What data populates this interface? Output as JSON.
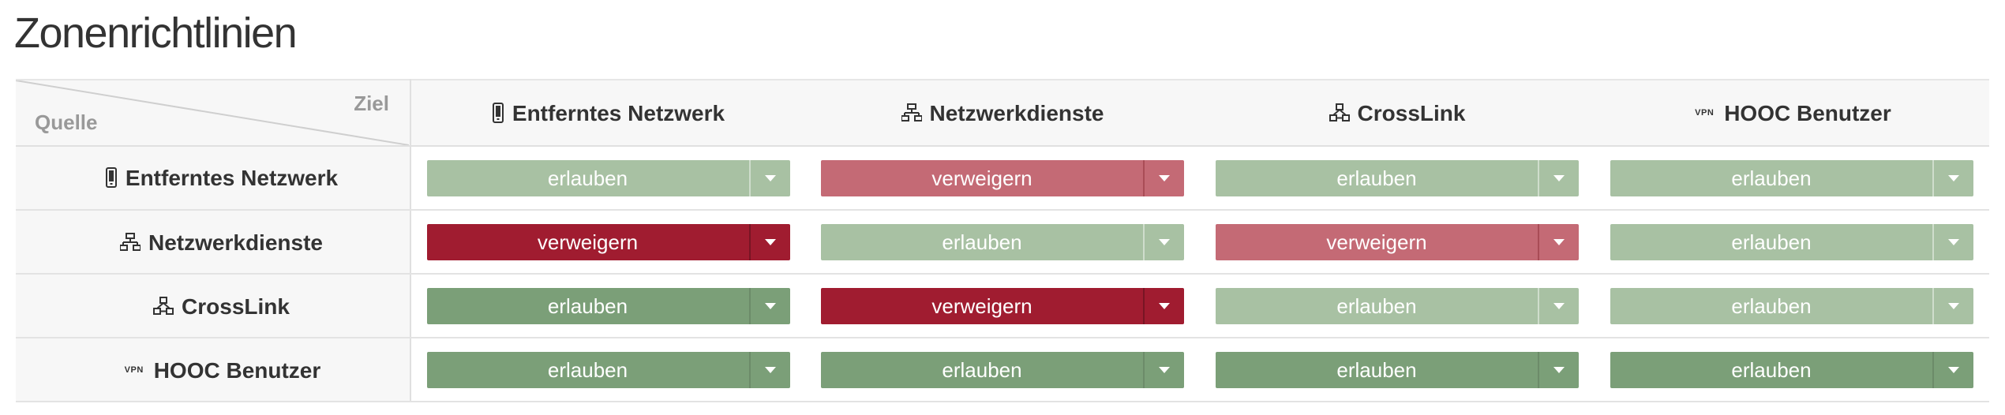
{
  "page": {
    "title": "Zonenrichtlinien"
  },
  "corner": {
    "target_label": "Ziel",
    "source_label": "Quelle"
  },
  "zones": [
    {
      "key": "remote",
      "label": "Entferntes Netzwerk",
      "icon": "mobile-device-icon"
    },
    {
      "key": "services",
      "label": "Netzwerkdienste",
      "icon": "network-services-icon"
    },
    {
      "key": "crosslink",
      "label": "CrossLink",
      "icon": "crosslink-icon"
    },
    {
      "key": "hooc",
      "label": "HOOC Benutzer",
      "icon": "vpn-icon",
      "icon_text": "VPN"
    }
  ],
  "policy_matrix": [
    {
      "source": "Entferntes Netzwerk",
      "cells": [
        {
          "target": "Entferntes Netzwerk",
          "value": "erlauben",
          "style": "allow-light"
        },
        {
          "target": "Netzwerkdienste",
          "value": "verweigern",
          "style": "deny-light"
        },
        {
          "target": "CrossLink",
          "value": "erlauben",
          "style": "allow-light"
        },
        {
          "target": "HOOC Benutzer",
          "value": "erlauben",
          "style": "allow-light"
        }
      ]
    },
    {
      "source": "Netzwerkdienste",
      "cells": [
        {
          "target": "Entferntes Netzwerk",
          "value": "verweigern",
          "style": "deny-dark"
        },
        {
          "target": "Netzwerkdienste",
          "value": "erlauben",
          "style": "allow-light"
        },
        {
          "target": "CrossLink",
          "value": "verweigern",
          "style": "deny-light"
        },
        {
          "target": "HOOC Benutzer",
          "value": "erlauben",
          "style": "allow-light"
        }
      ]
    },
    {
      "source": "CrossLink",
      "cells": [
        {
          "target": "Entferntes Netzwerk",
          "value": "erlauben",
          "style": "allow-dark"
        },
        {
          "target": "Netzwerkdienste",
          "value": "verweigern",
          "style": "deny-dark"
        },
        {
          "target": "CrossLink",
          "value": "erlauben",
          "style": "allow-light"
        },
        {
          "target": "HOOC Benutzer",
          "value": "erlauben",
          "style": "allow-light"
        }
      ]
    },
    {
      "source": "HOOC Benutzer",
      "cells": [
        {
          "target": "Entferntes Netzwerk",
          "value": "erlauben",
          "style": "allow-dark"
        },
        {
          "target": "Netzwerkdienste",
          "value": "erlauben",
          "style": "allow-dark"
        },
        {
          "target": "CrossLink",
          "value": "erlauben",
          "style": "allow-dark"
        },
        {
          "target": "HOOC Benutzer",
          "value": "erlauben",
          "style": "allow-dark"
        }
      ]
    }
  ],
  "colors": {
    "allow_light": "#a8c1a3",
    "allow_dark": "#7b9f78",
    "deny_light": "#c46a75",
    "deny_dark": "#a01c30",
    "header_bg": "#f7f7f7"
  }
}
